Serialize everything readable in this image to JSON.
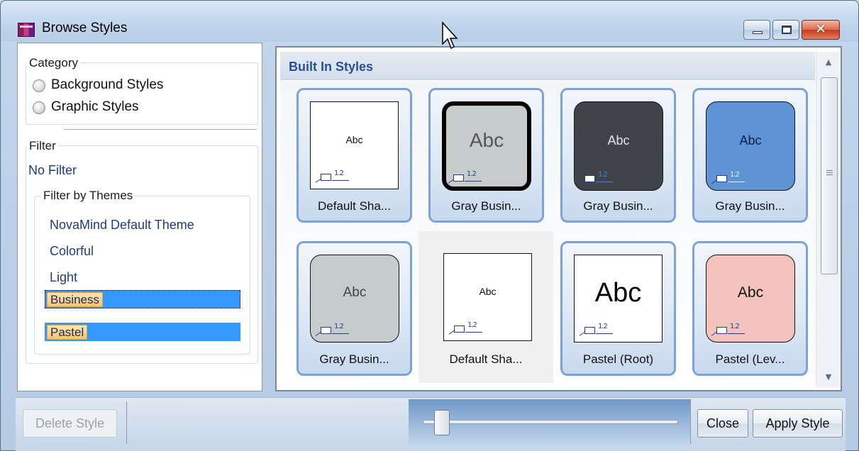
{
  "window": {
    "title": "Browse Styles",
    "controls": {
      "minimize": "minimize",
      "maximize": "maximize",
      "close": "✕"
    }
  },
  "category": {
    "legend": "Category",
    "options": [
      {
        "label": "Background Styles",
        "selected": false
      },
      {
        "label": "Graphic Styles",
        "selected": false
      }
    ]
  },
  "filter": {
    "legend": "Filter",
    "no_filter": "No Filter",
    "themes_legend": "Filter by Themes",
    "themes": [
      {
        "label": "NovaMind Default Theme",
        "selected": false
      },
      {
        "label": "Colorful",
        "selected": false
      },
      {
        "label": "Light",
        "selected": false
      },
      {
        "label": "Business",
        "selected": true
      },
      {
        "label": "Pastel",
        "selected": true
      }
    ]
  },
  "styles": {
    "section_title": "Built In Styles",
    "items": [
      {
        "label": "Default Sha...",
        "preview_text": "Abc"
      },
      {
        "label": "Gray Busin...",
        "preview_text": "Abc"
      },
      {
        "label": "Gray Busin...",
        "preview_text": "Abc"
      },
      {
        "label": "Gray Busin...",
        "preview_text": "Abc"
      },
      {
        "label": "Gray Busin...",
        "preview_text": "Abc"
      },
      {
        "label": "Default Sha...",
        "preview_text": "Abc"
      },
      {
        "label": "Pastel (Root)",
        "preview_text": "Abc"
      },
      {
        "label": "Pastel (Lev...",
        "preview_text": "Abc"
      }
    ],
    "mini_number": "1.2"
  },
  "footer": {
    "delete_label": "Delete Style",
    "close_label": "Close",
    "apply_label": "Apply Style",
    "zoom_slider_level": 0.05
  },
  "colors": {
    "accent": "#274f9d",
    "selection": "#3399ff",
    "card_border": "#7da2d6",
    "pastel_pink": "#f4c3bd",
    "business_blue": "#5e93d6",
    "business_dark": "#404448",
    "business_gray": "#c6cbcb"
  }
}
